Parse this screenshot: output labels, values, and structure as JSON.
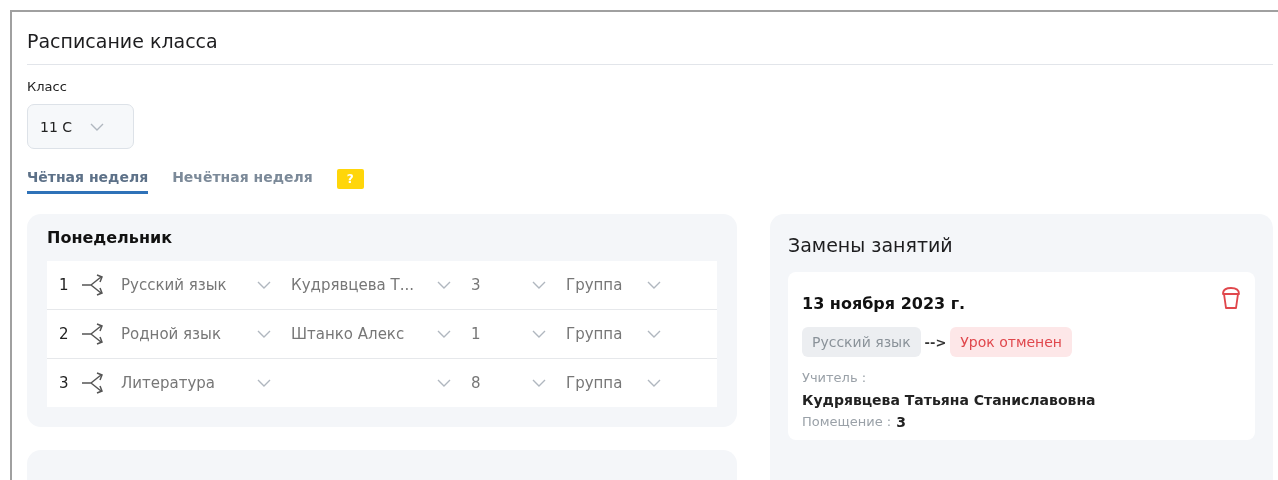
{
  "title": "Расписание класса",
  "class_select": {
    "label": "Класс",
    "value": "11 С"
  },
  "tabs": [
    {
      "label": "Чётная неделя",
      "selected": true
    },
    {
      "label": "Нечётная неделя",
      "selected": false
    }
  ],
  "help_badge": "?",
  "days": [
    {
      "name": "Понедельник",
      "lessons": [
        {
          "number": "1",
          "subject": "Русский язык",
          "teacher": "Кудрявцева Т...",
          "room": "3",
          "group": "Группа"
        },
        {
          "number": "2",
          "subject": "Родной язык",
          "teacher": "Штанко Алекс",
          "room": "1",
          "group": "Группа"
        },
        {
          "number": "3",
          "subject": "Литература",
          "room": "8",
          "group": "Группа"
        }
      ]
    }
  ],
  "replacements": {
    "title": "Замены занятий",
    "items": [
      {
        "date": "13 ноября 2023 г.",
        "from": "Русский язык",
        "arrow": "-->",
        "to": "Урок отменен",
        "teacher_label": "Учитель :",
        "teacher": "Кудрявцева Татьяна Станиславовна",
        "room_label": "Помещение :",
        "room": "3"
      }
    ]
  }
}
